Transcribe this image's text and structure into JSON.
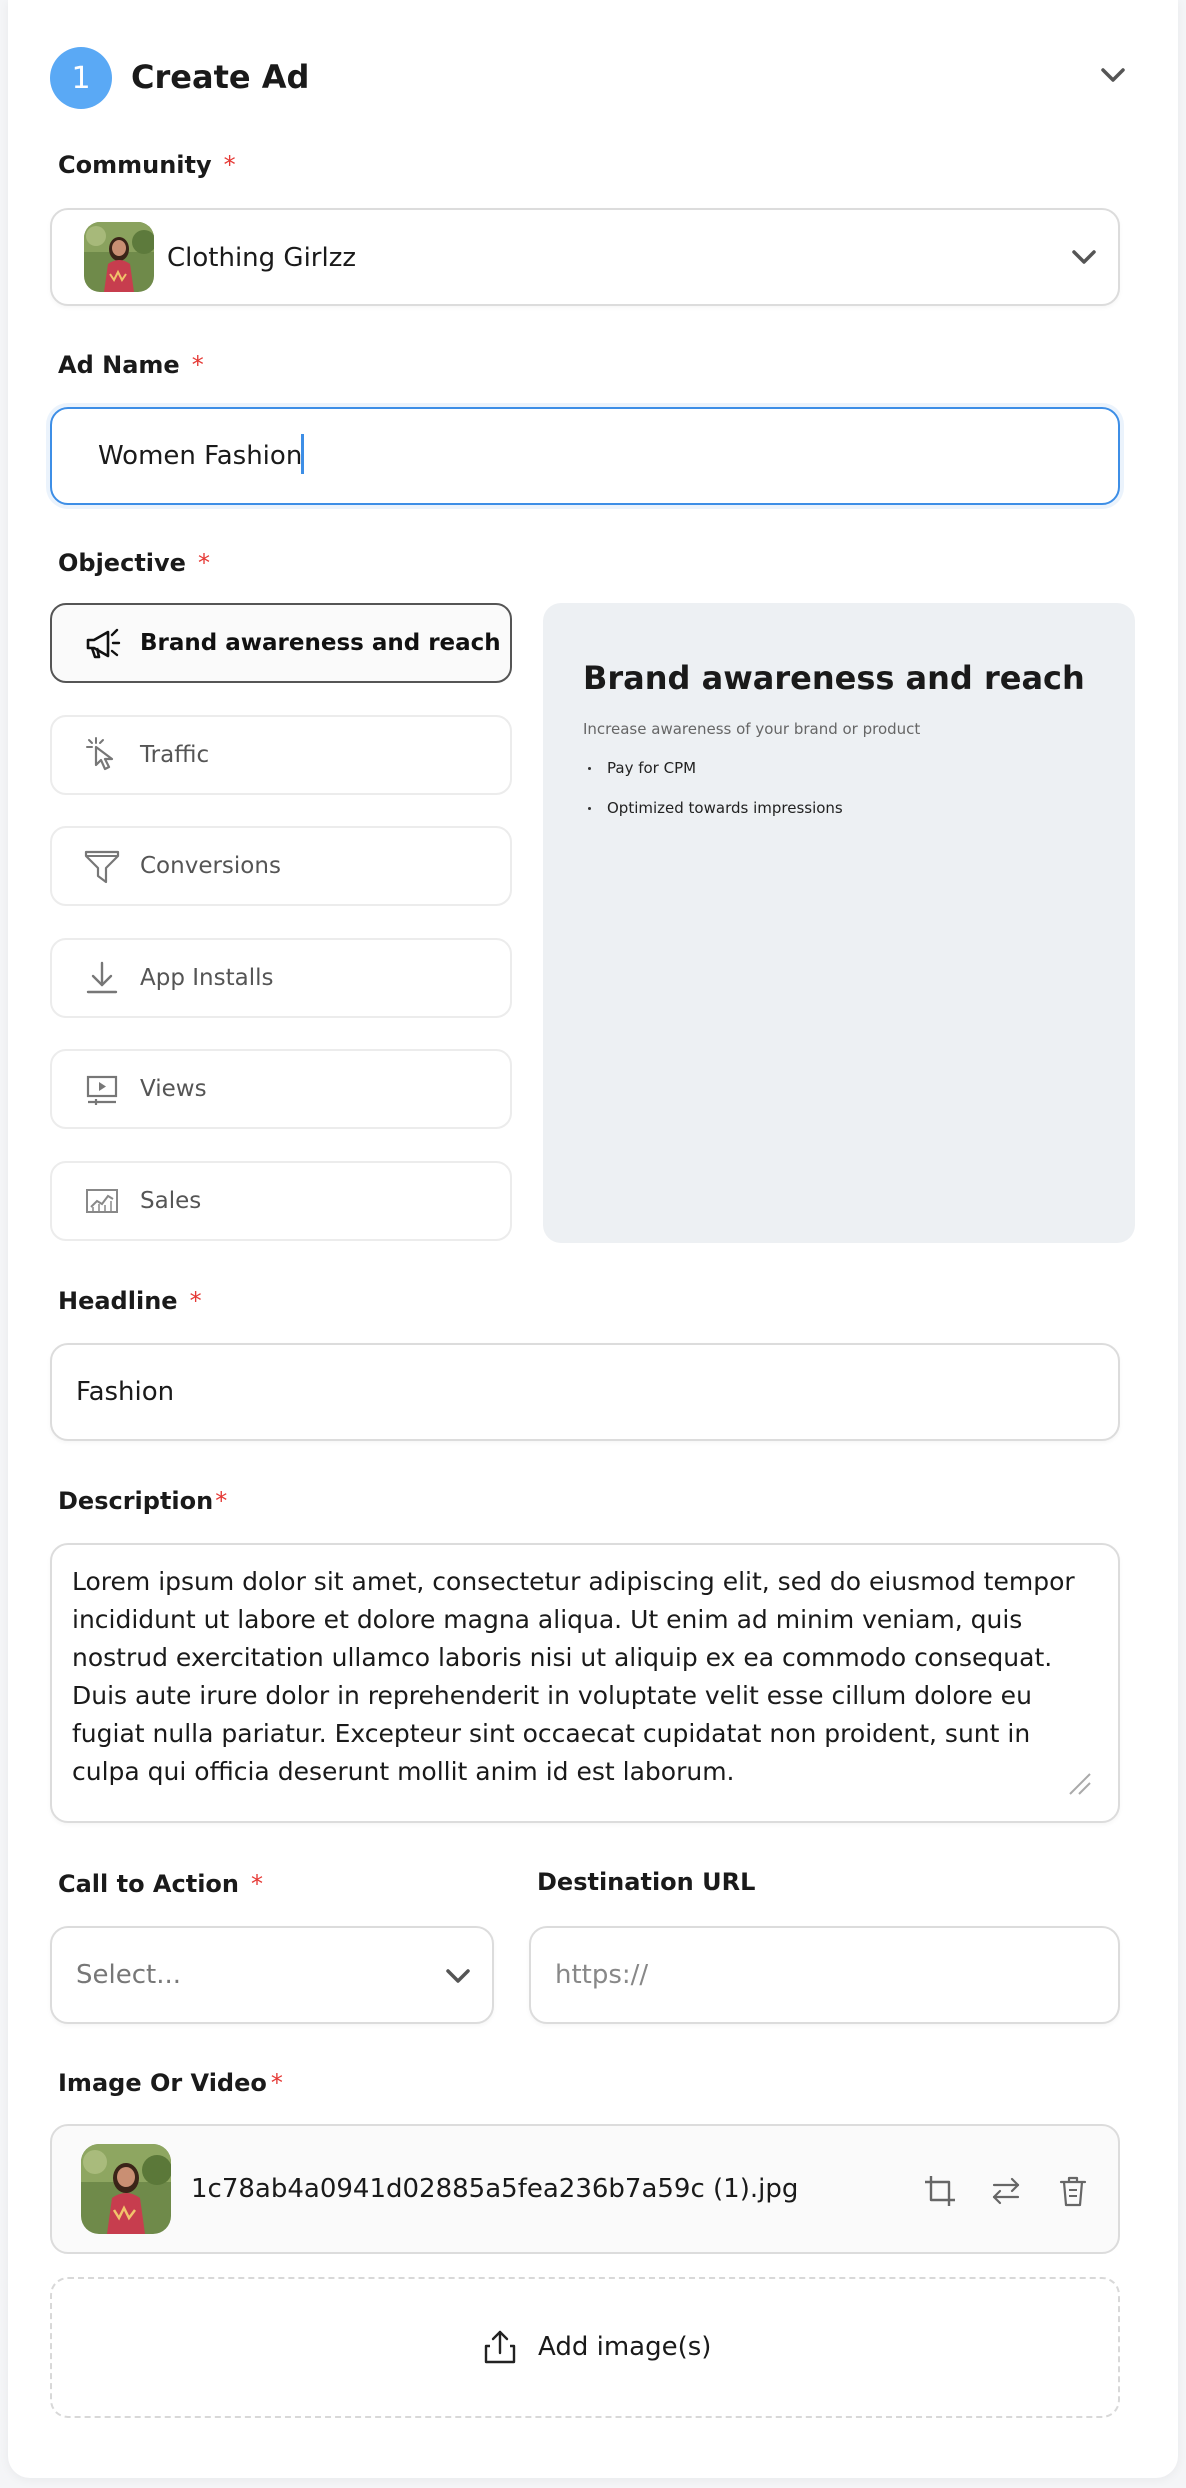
{
  "header": {
    "step_number": "1",
    "title": "Create Ad"
  },
  "community": {
    "label": "Community",
    "required_mark": "*",
    "selected": "Clothing Girlzz"
  },
  "ad_name": {
    "label": "Ad Name",
    "required_mark": "*",
    "value": "Women Fashion"
  },
  "objective": {
    "label": "Objective",
    "required_mark": "*",
    "options": [
      {
        "label": "Brand awareness and reach",
        "icon": "megaphone-icon",
        "selected": true
      },
      {
        "label": "Traffic",
        "icon": "pointer-click-icon",
        "selected": false
      },
      {
        "label": "Conversions",
        "icon": "funnel-icon",
        "selected": false
      },
      {
        "label": "App Installs",
        "icon": "download-icon",
        "selected": false
      },
      {
        "label": "Views",
        "icon": "play-screen-icon",
        "selected": false
      },
      {
        "label": "Sales",
        "icon": "sales-chart-icon",
        "selected": false
      }
    ],
    "detail": {
      "title": "Brand awareness and reach",
      "subtitle": "Increase awareness of your brand or product",
      "bullets": [
        "Pay for CPM",
        "Optimized towards impressions"
      ]
    }
  },
  "headline": {
    "label": "Headline",
    "required_mark": "*",
    "value": "Fashion"
  },
  "description": {
    "label": "Description",
    "required_mark": "*",
    "value": "Lorem ipsum dolor sit amet, consectetur adipiscing elit, sed do eiusmod tempor incididunt ut labore et dolore magna aliqua. Ut enim ad minim veniam, quis nostrud exercitation ullamco laboris nisi ut aliquip ex ea commodo consequat. Duis aute irure dolor in reprehenderit in voluptate velit esse cillum dolore eu fugiat nulla pariatur. Excepteur sint occaecat cupidatat non proident, sunt in culpa qui officia deserunt mollit anim id est laborum."
  },
  "call_to_action": {
    "label": "Call to Action",
    "required_mark": "*",
    "value": "Select..."
  },
  "destination_url": {
    "label": "Destination URL",
    "placeholder": "https://"
  },
  "media": {
    "label": "Image Or Video",
    "required_mark": "*",
    "file_name": "1c78ab4a0941d02885a5fea236b7a59c (1).jpg",
    "add_label": "Add image(s)"
  },
  "colors": {
    "accent": "#3d8ee6",
    "step_badge": "#5aa9f5",
    "required": "#e53935",
    "panel_bg": "#edf0f3"
  }
}
